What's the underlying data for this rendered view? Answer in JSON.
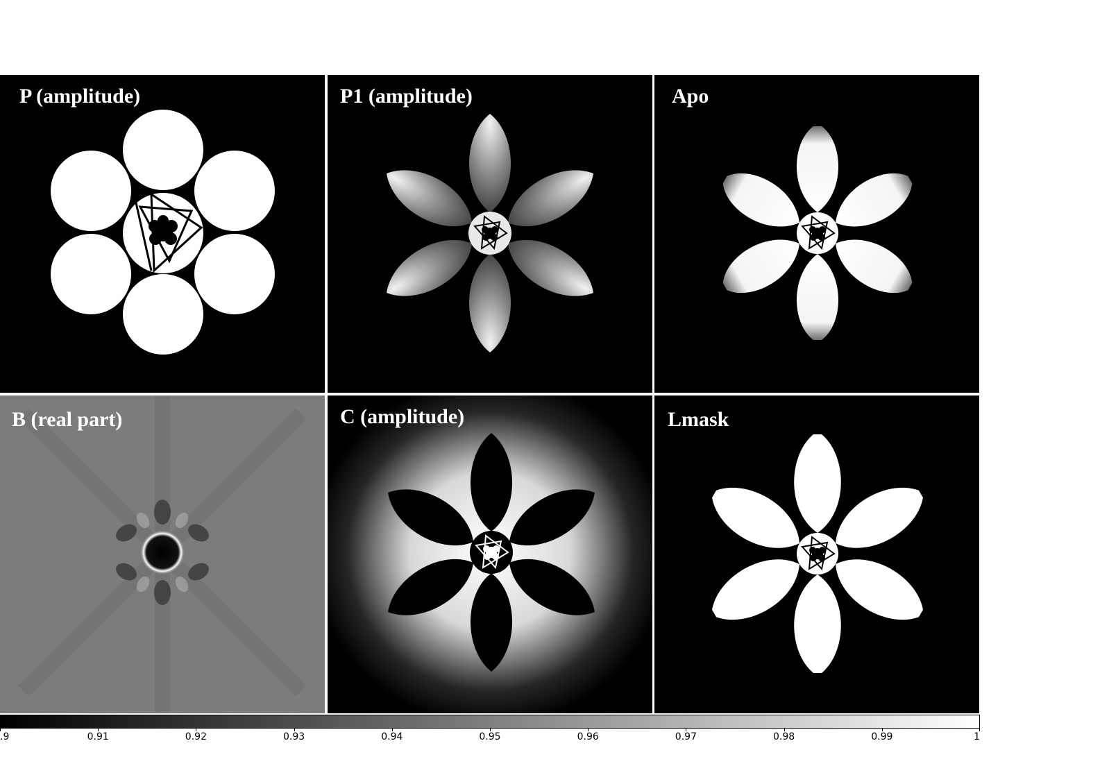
{
  "panels": {
    "p": {
      "title": "P (amplitude)"
    },
    "p1": {
      "title": "P1 (amplitude)"
    },
    "apo": {
      "title": "Apo"
    },
    "b": {
      "title": "B (real part)"
    },
    "c": {
      "title": "C (amplitude)"
    },
    "lmask": {
      "title": "Lmask"
    }
  },
  "colorbar": {
    "min": 0.9,
    "max": 1.0,
    "ticks": [
      {
        "value": 0.9,
        "label": ".9"
      },
      {
        "value": 0.91,
        "label": "0.91"
      },
      {
        "value": 0.92,
        "label": "0.92"
      },
      {
        "value": 0.93,
        "label": "0.93"
      },
      {
        "value": 0.94,
        "label": "0.94"
      },
      {
        "value": 0.95,
        "label": "0.95"
      },
      {
        "value": 0.96,
        "label": "0.96"
      },
      {
        "value": 0.97,
        "label": "0.97"
      },
      {
        "value": 0.98,
        "label": "0.98"
      },
      {
        "value": 0.99,
        "label": "0.99"
      },
      {
        "value": 1.0,
        "label": "1"
      }
    ],
    "color_low": "#000000",
    "color_high": "#ffffff"
  }
}
